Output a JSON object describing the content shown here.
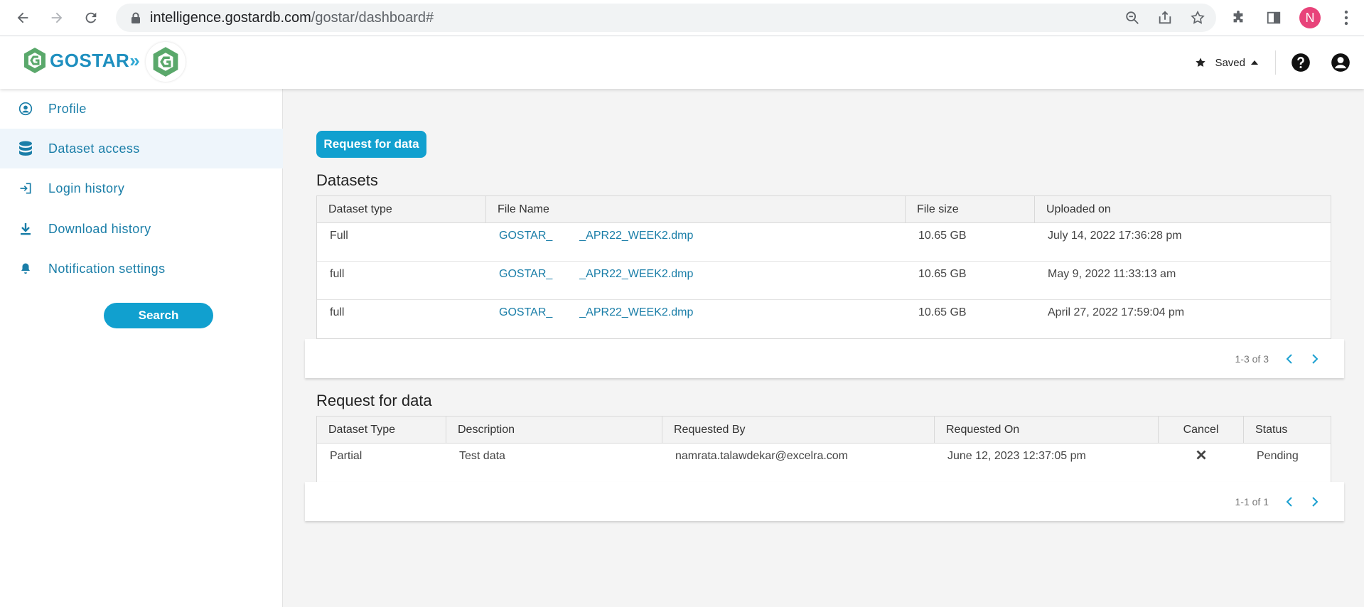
{
  "browser": {
    "url_domain": "intelligence.gostardb.com",
    "url_path": "/gostar/dashboard#",
    "profile_initial": "N"
  },
  "header": {
    "logo_text": "GOSTAR",
    "saved_label": "Saved"
  },
  "sidebar": {
    "items": [
      {
        "label": "Profile",
        "icon": "user-circle-icon"
      },
      {
        "label": "Dataset access",
        "icon": "database-icon"
      },
      {
        "label": "Login history",
        "icon": "login-icon"
      },
      {
        "label": "Download history",
        "icon": "download-icon"
      },
      {
        "label": "Notification settings",
        "icon": "bell-icon"
      }
    ],
    "active_index": 1,
    "search_label": "Search"
  },
  "main": {
    "request_button_label": "Request for data",
    "datasets": {
      "title": "Datasets",
      "columns": [
        "Dataset type",
        "File Name",
        "File size",
        "Uploaded on"
      ],
      "rows": [
        {
          "type": "Full",
          "file_prefix": "GOSTAR_",
          "file_suffix": "_APR22_WEEK2.dmp",
          "size": "10.65 GB",
          "uploaded": "July 14, 2022 17:36:28 pm"
        },
        {
          "type": "full",
          "file_prefix": "GOSTAR_",
          "file_suffix": "_APR22_WEEK2.dmp",
          "size": "10.65 GB",
          "uploaded": "May 9, 2022 11:33:13 am"
        },
        {
          "type": "full",
          "file_prefix": "GOSTAR_",
          "file_suffix": "_APR22_WEEK2.dmp",
          "size": "10.65 GB",
          "uploaded": "April 27, 2022 17:59:04 pm"
        }
      ],
      "pager": "1-3 of 3"
    },
    "requests": {
      "title": "Request for data",
      "columns": [
        "Dataset Type",
        "Description",
        "Requested By",
        "Requested On",
        "Cancel",
        "Status"
      ],
      "rows": [
        {
          "type": "Partial",
          "description": "Test data",
          "requested_by": "namrata.talawdekar@excelra.com",
          "requested_on": "June 12, 2023 12:37:05 pm",
          "status": "Pending"
        }
      ],
      "pager": "1-1 of 1"
    }
  },
  "colors": {
    "accent": "#11a0cf",
    "link": "#1a7ea8",
    "avatar": "#e8437a"
  }
}
